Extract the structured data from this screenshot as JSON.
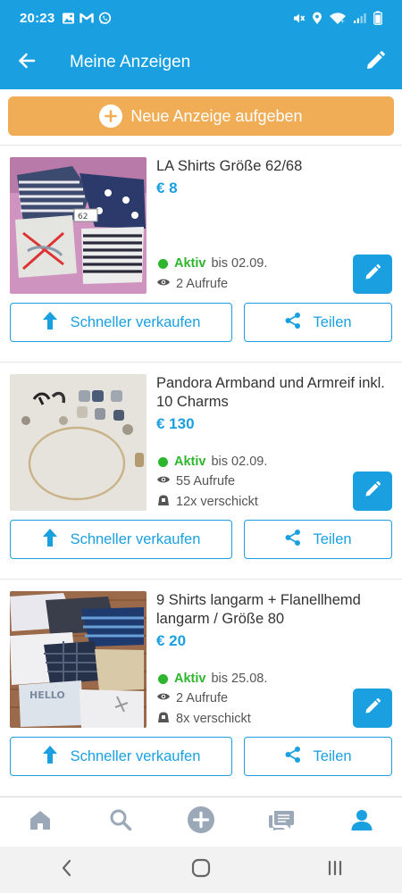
{
  "status_bar": {
    "time": "20:23",
    "left_icons": [
      "gallery-icon",
      "gmail-icon",
      "whatsapp-icon"
    ],
    "right_icons": [
      "mute-icon",
      "location-icon",
      "wifi-icon",
      "signal-icon",
      "battery-icon"
    ]
  },
  "app_bar": {
    "title": "Meine Anzeigen",
    "back_icon": "arrow-left-icon",
    "edit_icon": "pencil-icon"
  },
  "new_listing": {
    "label": "Neue Anzeige aufgeben",
    "icon": "plus-circle-icon"
  },
  "listings": [
    {
      "title": "LA Shirts Größe 62/68",
      "price": "€ 8",
      "status": "Aktiv",
      "until": "bis 02.09.",
      "views": "2 Aufrufe",
      "sent": ""
    },
    {
      "title": "Pandora Armband und Armreif inkl. 10 Charms",
      "price": "€ 130",
      "status": "Aktiv",
      "until": "bis 02.09.",
      "views": "55 Aufrufe",
      "sent": "12x verschickt"
    },
    {
      "title": "9 Shirts langarm + Flanellhemd langarm / Größe 80",
      "price": "€ 20",
      "status": "Aktiv",
      "until": "bis 25.08.",
      "views": "2 Aufrufe",
      "sent": "8x verschickt"
    }
  ],
  "buttons": {
    "sell_faster": "Schneller verkaufen",
    "share": "Teilen"
  },
  "bottom_nav": [
    "home-icon",
    "search-icon",
    "add-icon",
    "messages-icon",
    "profile-icon"
  ],
  "system_nav": [
    "back-icon",
    "home-icon",
    "recents-icon"
  ],
  "colors": {
    "primary": "#1aa0e0",
    "accent": "#f0ad55",
    "active_green": "#2eb52e",
    "nav_inactive": "#9aa8b8"
  }
}
